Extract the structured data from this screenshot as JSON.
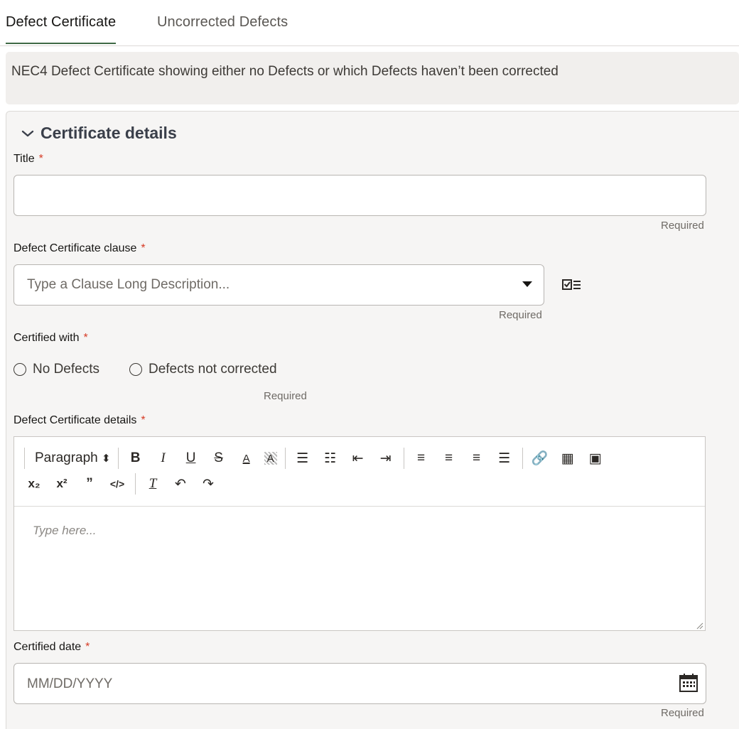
{
  "tabs": [
    {
      "label": "Defect Certificate",
      "active": true
    },
    {
      "label": "Uncorrected Defects",
      "active": false
    }
  ],
  "banner": {
    "text": "NEC4 Defect Certificate showing either no Defects or which Defects haven’t been corrected"
  },
  "section": {
    "title": "Certificate details",
    "icon": "chevron-down-icon"
  },
  "fields": {
    "title": {
      "label": "Title",
      "required_mark": "*",
      "value": "",
      "hint": "Required"
    },
    "clause": {
      "label": "Defect Certificate clause",
      "required_mark": "*",
      "placeholder": "Type a Clause Long Description...",
      "hint": "Required",
      "icon": "list-select-icon"
    },
    "certified_with": {
      "label": "Certified with",
      "required_mark": "*",
      "options": [
        "No Defects",
        "Defects not corrected"
      ],
      "hint": "Required"
    },
    "details": {
      "label": "Defect Certificate details",
      "required_mark": "*",
      "placeholder": "Type here...",
      "block_format": "Paragraph"
    },
    "date": {
      "label": "Certified date",
      "required_mark": "*",
      "placeholder": "MM/DD/YYYY",
      "hint": "Required",
      "icon": "calendar-icon"
    }
  },
  "colors": {
    "accent": "#3f6a46",
    "required": "#d63b25",
    "panel_bg": "#f6f5f4",
    "banner_bg": "#f1efed"
  }
}
